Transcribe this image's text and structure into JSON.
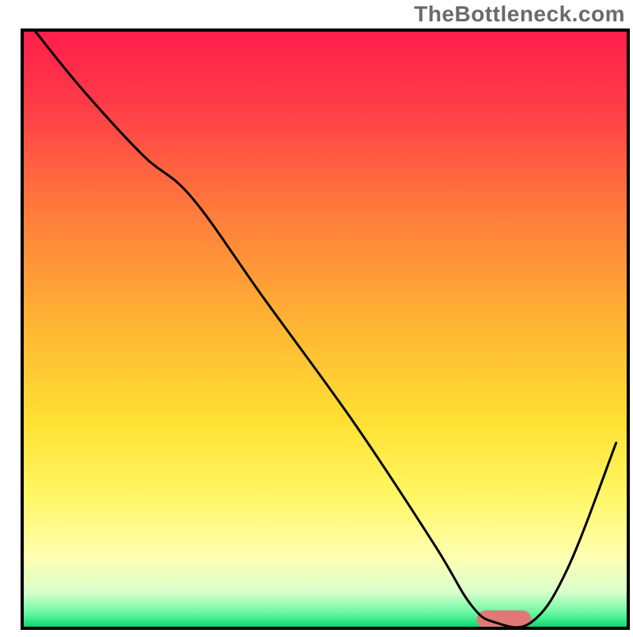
{
  "attribution": "TheBottleneck.com",
  "chart_data": {
    "type": "line",
    "title": "",
    "xlabel": "",
    "ylabel": "",
    "xlim": [
      0,
      100
    ],
    "ylim": [
      0,
      100
    ],
    "background_gradient_stops": [
      {
        "pos": 0.0,
        "color": "#ff1d4b"
      },
      {
        "pos": 0.12,
        "color": "#ff3a47"
      },
      {
        "pos": 0.3,
        "color": "#ff7a3c"
      },
      {
        "pos": 0.5,
        "color": "#ffb733"
      },
      {
        "pos": 0.66,
        "color": "#ffe233"
      },
      {
        "pos": 0.78,
        "color": "#fff766"
      },
      {
        "pos": 0.88,
        "color": "#ffffb0"
      },
      {
        "pos": 0.94,
        "color": "#d8ffcc"
      },
      {
        "pos": 0.975,
        "color": "#66f7a0"
      },
      {
        "pos": 1.0,
        "color": "#00d46a"
      }
    ],
    "series": [
      {
        "name": "bottleneck-curve",
        "type": "line",
        "stroke": "#000000",
        "stroke_width": 3,
        "x": [
          2,
          10,
          20,
          28,
          40,
          55,
          68,
          74,
          78,
          84,
          90,
          98
        ],
        "y": [
          100,
          90,
          79,
          72,
          55,
          34,
          14,
          4,
          1,
          1,
          10,
          31
        ]
      }
    ],
    "marker": {
      "name": "optimal-zone",
      "shape": "rounded-bar",
      "color": "#e17878",
      "x_start": 75,
      "x_end": 84,
      "y": 1.5,
      "height": 3
    },
    "frame": {
      "stroke": "#000000",
      "stroke_width": 4
    }
  }
}
